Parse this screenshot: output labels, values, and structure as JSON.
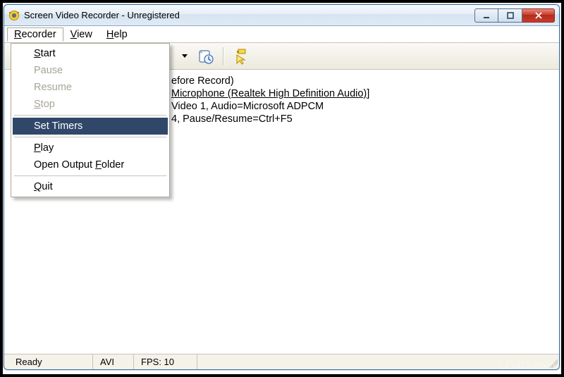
{
  "window": {
    "title": "Screen Video Recorder - Unregistered"
  },
  "menubar": {
    "items": [
      {
        "label": "Recorder",
        "mnemonic": "R",
        "open": true
      },
      {
        "label": "View",
        "mnemonic": "V",
        "open": false
      },
      {
        "label": "Help",
        "mnemonic": "H",
        "open": false
      }
    ]
  },
  "dropdown": {
    "items": [
      {
        "type": "item",
        "label": "Start",
        "mnemonic": "S",
        "enabled": true,
        "highlight": false
      },
      {
        "type": "item",
        "label": "Pause",
        "mnemonic": "",
        "enabled": false,
        "highlight": false
      },
      {
        "type": "item",
        "label": "Resume",
        "mnemonic": "",
        "enabled": false,
        "highlight": false
      },
      {
        "type": "item",
        "label": "Stop",
        "mnemonic": "S",
        "enabled": false,
        "highlight": false
      },
      {
        "type": "sep"
      },
      {
        "type": "item",
        "label": "Set Timers",
        "mnemonic": "",
        "enabled": true,
        "highlight": true
      },
      {
        "type": "sep"
      },
      {
        "type": "item",
        "label": "Play",
        "mnemonic": "P",
        "enabled": true,
        "highlight": false
      },
      {
        "type": "item",
        "label": "Open Output Folder",
        "mnemonic": "F",
        "enabled": true,
        "highlight": false
      },
      {
        "type": "sep"
      },
      {
        "type": "item",
        "label": "Quit",
        "mnemonic": "Q",
        "enabled": true,
        "highlight": false
      }
    ]
  },
  "content": {
    "line1_suffix": "efore Record)",
    "line2_link": "Microphone (Realtek High Definition Audio)]",
    "line3": "Video 1, Audio=Microsoft ADPCM",
    "line4": "4, Pause/Resume=Ctrl+F5"
  },
  "statusbar": {
    "ready": "Ready",
    "format": "AVI",
    "fps": "FPS: 10"
  },
  "watermark": "LO4D.com"
}
